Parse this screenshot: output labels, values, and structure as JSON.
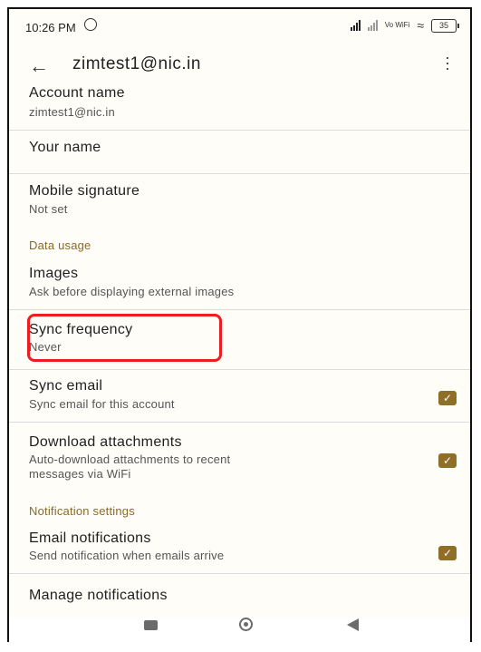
{
  "status_bar": {
    "time": "10:26 PM",
    "network": "Vo WiFi",
    "battery": "35"
  },
  "app_bar": {
    "title": "zimtest1@nic.in"
  },
  "settings": {
    "account_name": {
      "title": "Account name",
      "subtitle": "zimtest1@nic.in"
    },
    "your_name": {
      "title": "Your name"
    },
    "mobile_signature": {
      "title": "Mobile signature",
      "subtitle": "Not set"
    },
    "data_usage_header": "Data usage",
    "images": {
      "title": "Images",
      "subtitle": "Ask before displaying external images"
    },
    "sync_frequency": {
      "title": "Sync frequency",
      "subtitle": "Never"
    },
    "sync_email": {
      "title": "Sync email",
      "subtitle": "Sync email for this account",
      "checked": true
    },
    "download_attachments": {
      "title": "Download attachments",
      "subtitle_line1": "Auto-download attachments to recent",
      "subtitle_line2": "messages via WiFi",
      "checked": true
    },
    "notification_settings_header": "Notification settings",
    "email_notifications": {
      "title": "Email notifications",
      "subtitle": "Send notification when emails arrive",
      "checked": true
    },
    "manage_notifications": {
      "title": "Manage notifications"
    }
  },
  "colors": {
    "accent": "#8f6f28",
    "highlight": "#ee1b23"
  },
  "icons": {
    "alarm": "alarm-icon",
    "back": "back-arrow-icon",
    "more": "more-vert-icon",
    "check": "checkmark-icon"
  }
}
